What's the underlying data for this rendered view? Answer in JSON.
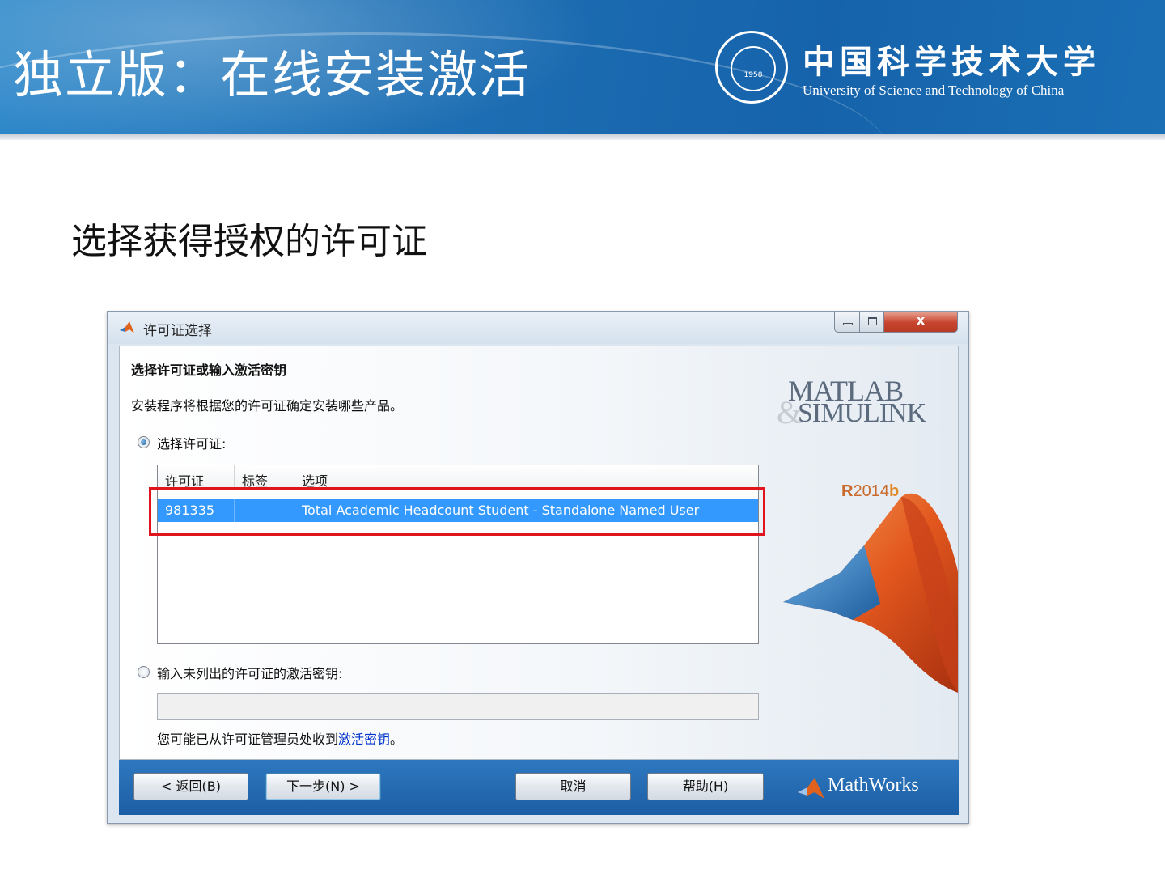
{
  "slide": {
    "title": "独立版：在线安装激活",
    "subtitle": "选择获得授权的许可证",
    "logo_cn": "中国科学技术大学",
    "logo_en": "University of Science and Technology of China",
    "seal_year": "1958",
    "banner_color": "#1e70b5"
  },
  "dialog": {
    "title": "许可证选择",
    "close_label": "x",
    "heading": "选择许可证或输入激活密钥",
    "description": "安装程序将根据您的许可证确定安装哪些产品。",
    "option_select_license": "选择许可证:",
    "option_enter_key": "输入未列出的许可证的激活密钥:",
    "table": {
      "columns": [
        "许可证",
        "标签",
        "选项"
      ],
      "rows": [
        {
          "license": "981335",
          "label": "",
          "option": "Total Academic Headcount Student - Standalone Named User",
          "selected": true
        }
      ]
    },
    "activation_key_value": "",
    "hint_prefix": "您可能已从许可证管理员处收到",
    "hint_link": "激活密钥",
    "hint_suffix": "。",
    "brand_matlab": "MATLAB",
    "brand_simulink": "SIMULINK",
    "brand_amp": "&",
    "release_r": "R",
    "release_year": "2014",
    "release_b": "b",
    "buttons": {
      "back": "< 返回(B)",
      "next": "下一步(N) >",
      "cancel": "取消",
      "help": "帮助(H)"
    },
    "mathworks": "MathWorks",
    "selection_color": "#3399ff",
    "highlight_color": "#e0141c"
  }
}
